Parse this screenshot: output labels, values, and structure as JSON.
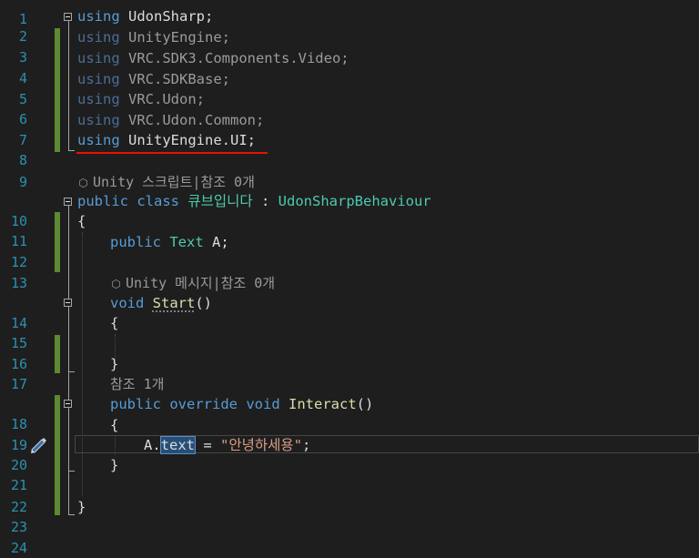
{
  "line_numbers": [
    "1",
    "2",
    "3",
    "4",
    "5",
    "6",
    "7",
    "8",
    "9",
    "10",
    "11",
    "12",
    "13",
    "14",
    "15",
    "16",
    "17",
    "18",
    "19",
    "20",
    "21",
    "22",
    "23",
    "24"
  ],
  "code": {
    "l2": {
      "kw": "using",
      "rest": " UdonSharp;"
    },
    "l3": {
      "kw": "using",
      "rest": " UnityEngine;"
    },
    "l4": {
      "kw": "using",
      "rest": " VRC.SDK3.Components.Video;"
    },
    "l5": {
      "kw": "using",
      "rest": " VRC.SDKBase;"
    },
    "l6": {
      "kw": "using",
      "rest": " VRC.Udon;"
    },
    "l7": {
      "kw": "using",
      "rest": " VRC.Udon.Common;"
    },
    "l8": {
      "kw": "using",
      "rest": " UnityEngine.UI;"
    },
    "codelens_class": "Unity 스크립트|참조 0개",
    "l10": {
      "kw1": "public",
      "kw2": "class",
      "name": "큐브입니다",
      "colon": " : ",
      "base": "UdonSharpBehaviour"
    },
    "l11": "{",
    "l12": {
      "kw": "public",
      "type": "Text",
      "field": "A;"
    },
    "codelens_start": "Unity 메시지|참조 0개",
    "l14": {
      "kw": "void",
      "name": "Start",
      "parens": "()"
    },
    "l15": "{",
    "l17": "}",
    "codelens_interact": "참조 1개",
    "l18": {
      "kw1": "public",
      "kw2": "override",
      "kw3": "void",
      "name": "Interact",
      "parens": "()"
    },
    "l19": "{",
    "l20": {
      "obj": "A.",
      "member": "text",
      "assign": " = ",
      "str": "\"안녕하세용\"",
      "end": ";"
    },
    "l21": "}",
    "l23": "}"
  },
  "colors": {
    "background": "#1e1e1e",
    "keyword": "#569cd6",
    "type": "#4ec9b0",
    "string": "#d69d85",
    "line_number": "#2b91af",
    "change_bar": "#5c8a32",
    "annotation": "#e51400"
  },
  "icons": {
    "codelens": "unity-cube-icon",
    "margin": "pencil-edit-icon"
  }
}
